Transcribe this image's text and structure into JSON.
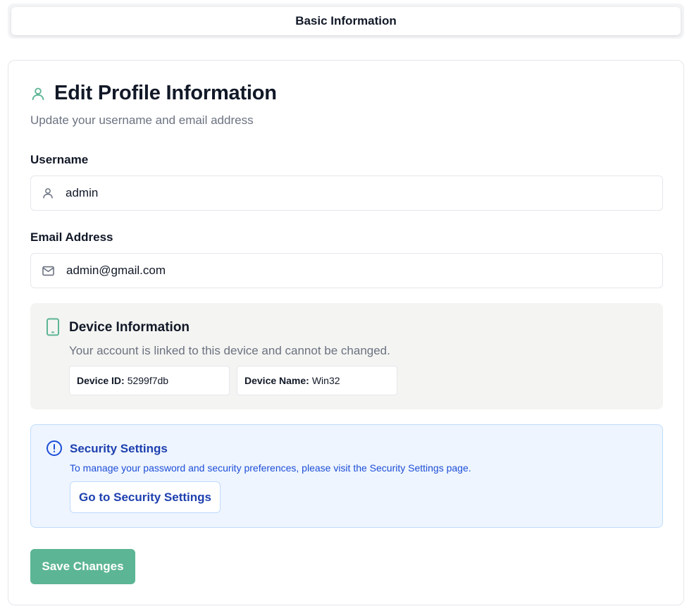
{
  "tabs": {
    "active_label": "Basic Information"
  },
  "profile": {
    "title": "Edit Profile Information",
    "subtitle": "Update your username and email address",
    "icon": "user-icon",
    "accent_color": "#5cb594"
  },
  "fields": {
    "username": {
      "label": "Username",
      "value": "admin",
      "icon": "user-icon"
    },
    "email": {
      "label": "Email Address",
      "value": "admin@gmail.com",
      "icon": "mail-icon"
    }
  },
  "device": {
    "title": "Device Information",
    "description": "Your account is linked to this device and cannot be changed.",
    "icon": "smartphone-icon",
    "id_label": "Device ID:",
    "id_value": "5299f7db",
    "name_label": "Device Name:",
    "name_value": "Win32"
  },
  "security": {
    "title": "Security Settings",
    "description": "To manage your password and security preferences, please visit the Security Settings page.",
    "button_label": "Go to Security Settings",
    "icon": "alert-circle-icon",
    "accent_color": "#1e40af"
  },
  "actions": {
    "save_label": "Save Changes"
  }
}
